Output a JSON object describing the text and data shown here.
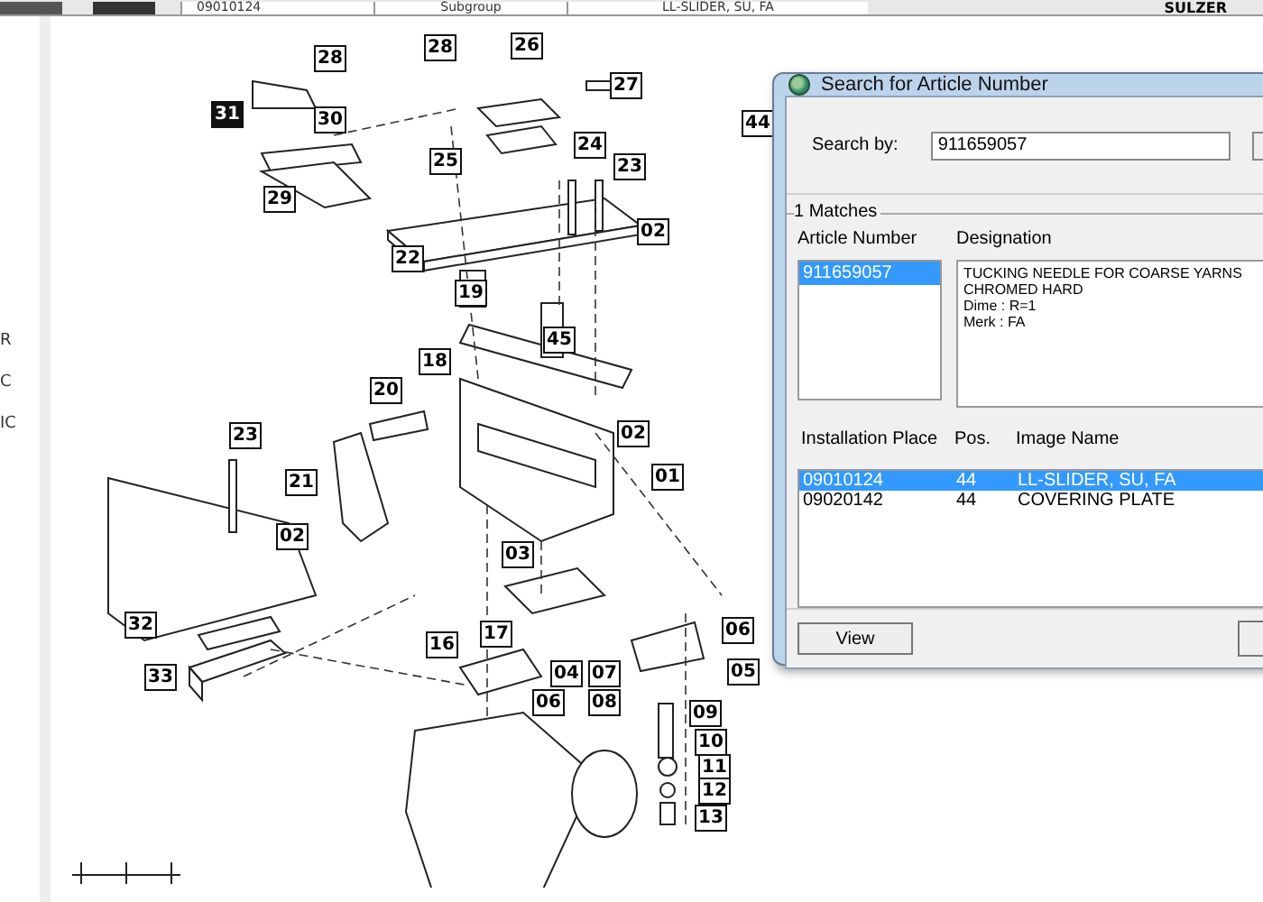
{
  "toolbar": {
    "fields": [
      "09010124",
      "Subgroup",
      "LL-SLIDER, SU, FA"
    ],
    "logo": "SULZER"
  },
  "side_labels": [
    "R",
    "C",
    "IC"
  ],
  "diagram": {
    "callouts": [
      {
        "label": "28",
        "highlighted": false
      },
      {
        "label": "28",
        "highlighted": false
      },
      {
        "label": "26",
        "highlighted": false
      },
      {
        "label": "27",
        "highlighted": false
      },
      {
        "label": "31",
        "highlighted": true
      },
      {
        "label": "30",
        "highlighted": false
      },
      {
        "label": "25",
        "highlighted": false
      },
      {
        "label": "24",
        "highlighted": false
      },
      {
        "label": "23",
        "highlighted": false
      },
      {
        "label": "29",
        "highlighted": false
      },
      {
        "label": "44",
        "highlighted": false
      },
      {
        "label": "22",
        "highlighted": false
      },
      {
        "label": "02",
        "highlighted": false
      },
      {
        "label": "19",
        "highlighted": false
      },
      {
        "label": "45",
        "highlighted": false
      },
      {
        "label": "18",
        "highlighted": false
      },
      {
        "label": "20",
        "highlighted": false
      },
      {
        "label": "23",
        "highlighted": false
      },
      {
        "label": "21",
        "highlighted": false
      },
      {
        "label": "02",
        "highlighted": false
      },
      {
        "label": "01",
        "highlighted": false
      },
      {
        "label": "02",
        "highlighted": false
      },
      {
        "label": "32",
        "highlighted": false
      },
      {
        "label": "03",
        "highlighted": false
      },
      {
        "label": "17",
        "highlighted": false
      },
      {
        "label": "16",
        "highlighted": false
      },
      {
        "label": "06",
        "highlighted": false
      },
      {
        "label": "33",
        "highlighted": false
      },
      {
        "label": "04",
        "highlighted": false
      },
      {
        "label": "07",
        "highlighted": false
      },
      {
        "label": "05",
        "highlighted": false
      },
      {
        "label": "06",
        "highlighted": false
      },
      {
        "label": "08",
        "highlighted": false
      },
      {
        "label": "09",
        "highlighted": false
      },
      {
        "label": "10",
        "highlighted": false
      },
      {
        "label": "11",
        "highlighted": false
      },
      {
        "label": "12",
        "highlighted": false
      },
      {
        "label": "13",
        "highlighted": false
      }
    ]
  },
  "dialog": {
    "title": "Search for Article Number",
    "search": {
      "label": "Search by:",
      "value": "911659057"
    },
    "matches_label": "1 Matches",
    "articles": {
      "header": "Article Number",
      "items": [
        {
          "text": "911659057",
          "selected": true
        }
      ]
    },
    "designation": {
      "header": "Designation",
      "lines": [
        "TUCKING NEEDLE FOR COARSE YARNS",
        "CHROMED HARD",
        "Dime : R=1",
        "Merk : FA"
      ]
    },
    "installations": {
      "columns": [
        "Installation Place",
        "Pos.",
        "Image Name"
      ],
      "rows": [
        {
          "cells": [
            "09010124",
            "44",
            "LL-SLIDER, SU, FA"
          ],
          "selected": true
        },
        {
          "cells": [
            "09020142",
            "44",
            "COVERING PLATE"
          ],
          "selected": false
        }
      ]
    },
    "buttons": [
      "View"
    ]
  }
}
